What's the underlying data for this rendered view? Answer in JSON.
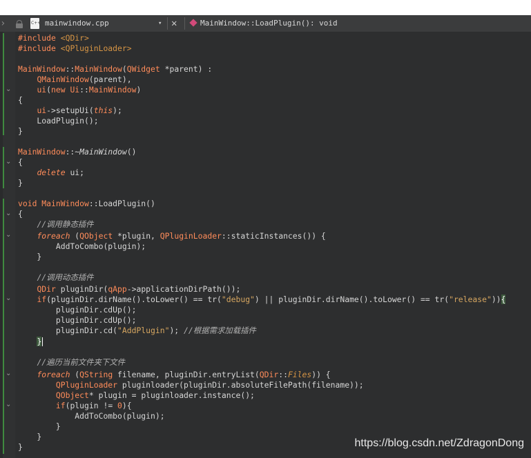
{
  "tab_bar": {
    "file_name": "mainwindow.cpp",
    "file_icon_text": "C++",
    "dropdown_glyph": "▾",
    "close_glyph": "✕",
    "function_signature": "MainWindow::LoadPlugin(): void",
    "left_arrow_glyph": "›"
  },
  "colors": {
    "editor_bg": "#2d2e2f",
    "keyword": "#ff8c5a",
    "string": "#d69545",
    "comment": "#b0b0b0",
    "text": "#d6d6d6",
    "change_marker": "#3f8a3f"
  },
  "code_lines": [
    "#include <QDir>",
    "#include <QPluginLoader>",
    "",
    "MainWindow::MainWindow(QWidget *parent) :",
    "    QMainWindow(parent),",
    "    ui(new Ui::MainWindow)",
    "{",
    "    ui->setupUi(this);",
    "    LoadPlugin();",
    "}",
    "",
    "MainWindow::~MainWindow()",
    "{",
    "    delete ui;",
    "}",
    "",
    "void MainWindow::LoadPlugin()",
    "{",
    "    //调用静态插件",
    "    foreach (QObject *plugin, QPluginLoader::staticInstances()) {",
    "        AddToCombo(plugin);",
    "    }",
    "",
    "    //调用动态插件",
    "    QDir pluginDir(qApp->applicationDirPath());",
    "    if(pluginDir.dirName().toLower() == tr(\"debug\") || pluginDir.dirName().toLower() == tr(\"release\")){",
    "        pluginDir.cdUp();",
    "        pluginDir.cdUp();",
    "        pluginDir.cd(\"AddPlugin\"); //根据需求加载插件",
    "    }",
    "",
    "    //遍历当前文件夹下文件",
    "    foreach (QString filename, pluginDir.entryList(QDir::Files)) {",
    "        QPluginLoader pluginloader(pluginDir.absoluteFilePath(filename));",
    "        QObject* plugin = pluginloader.instance();",
    "        if(plugin != 0){",
    "            AddToCombo(plugin);",
    "        }",
    "    }",
    "}"
  ],
  "watermark": "https://blog.csdn.net/ZdragonDong"
}
